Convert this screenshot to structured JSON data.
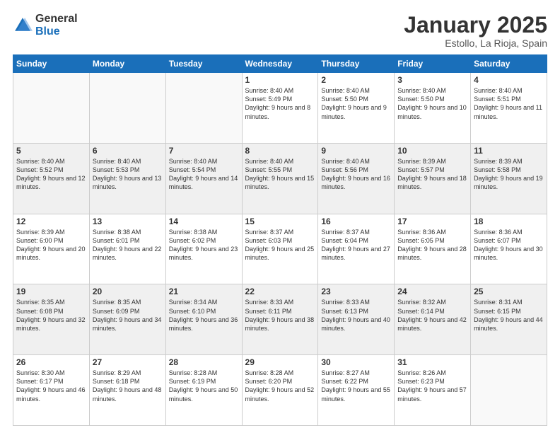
{
  "header": {
    "logo_general": "General",
    "logo_blue": "Blue",
    "month_title": "January 2025",
    "location": "Estollo, La Rioja, Spain"
  },
  "weekdays": [
    "Sunday",
    "Monday",
    "Tuesday",
    "Wednesday",
    "Thursday",
    "Friday",
    "Saturday"
  ],
  "weeks": [
    [
      {
        "day": "",
        "empty": true
      },
      {
        "day": "",
        "empty": true
      },
      {
        "day": "",
        "empty": true
      },
      {
        "day": "1",
        "sunrise": "8:40 AM",
        "sunset": "5:49 PM",
        "daylight": "9 hours and 8 minutes."
      },
      {
        "day": "2",
        "sunrise": "8:40 AM",
        "sunset": "5:50 PM",
        "daylight": "9 hours and 9 minutes."
      },
      {
        "day": "3",
        "sunrise": "8:40 AM",
        "sunset": "5:50 PM",
        "daylight": "9 hours and 10 minutes."
      },
      {
        "day": "4",
        "sunrise": "8:40 AM",
        "sunset": "5:51 PM",
        "daylight": "9 hours and 11 minutes."
      }
    ],
    [
      {
        "day": "5",
        "sunrise": "8:40 AM",
        "sunset": "5:52 PM",
        "daylight": "9 hours and 12 minutes."
      },
      {
        "day": "6",
        "sunrise": "8:40 AM",
        "sunset": "5:53 PM",
        "daylight": "9 hours and 13 minutes."
      },
      {
        "day": "7",
        "sunrise": "8:40 AM",
        "sunset": "5:54 PM",
        "daylight": "9 hours and 14 minutes."
      },
      {
        "day": "8",
        "sunrise": "8:40 AM",
        "sunset": "5:55 PM",
        "daylight": "9 hours and 15 minutes."
      },
      {
        "day": "9",
        "sunrise": "8:40 AM",
        "sunset": "5:56 PM",
        "daylight": "9 hours and 16 minutes."
      },
      {
        "day": "10",
        "sunrise": "8:39 AM",
        "sunset": "5:57 PM",
        "daylight": "9 hours and 18 minutes."
      },
      {
        "day": "11",
        "sunrise": "8:39 AM",
        "sunset": "5:58 PM",
        "daylight": "9 hours and 19 minutes."
      }
    ],
    [
      {
        "day": "12",
        "sunrise": "8:39 AM",
        "sunset": "6:00 PM",
        "daylight": "9 hours and 20 minutes."
      },
      {
        "day": "13",
        "sunrise": "8:38 AM",
        "sunset": "6:01 PM",
        "daylight": "9 hours and 22 minutes."
      },
      {
        "day": "14",
        "sunrise": "8:38 AM",
        "sunset": "6:02 PM",
        "daylight": "9 hours and 23 minutes."
      },
      {
        "day": "15",
        "sunrise": "8:37 AM",
        "sunset": "6:03 PM",
        "daylight": "9 hours and 25 minutes."
      },
      {
        "day": "16",
        "sunrise": "8:37 AM",
        "sunset": "6:04 PM",
        "daylight": "9 hours and 27 minutes."
      },
      {
        "day": "17",
        "sunrise": "8:36 AM",
        "sunset": "6:05 PM",
        "daylight": "9 hours and 28 minutes."
      },
      {
        "day": "18",
        "sunrise": "8:36 AM",
        "sunset": "6:07 PM",
        "daylight": "9 hours and 30 minutes."
      }
    ],
    [
      {
        "day": "19",
        "sunrise": "8:35 AM",
        "sunset": "6:08 PM",
        "daylight": "9 hours and 32 minutes."
      },
      {
        "day": "20",
        "sunrise": "8:35 AM",
        "sunset": "6:09 PM",
        "daylight": "9 hours and 34 minutes."
      },
      {
        "day": "21",
        "sunrise": "8:34 AM",
        "sunset": "6:10 PM",
        "daylight": "9 hours and 36 minutes."
      },
      {
        "day": "22",
        "sunrise": "8:33 AM",
        "sunset": "6:11 PM",
        "daylight": "9 hours and 38 minutes."
      },
      {
        "day": "23",
        "sunrise": "8:33 AM",
        "sunset": "6:13 PM",
        "daylight": "9 hours and 40 minutes."
      },
      {
        "day": "24",
        "sunrise": "8:32 AM",
        "sunset": "6:14 PM",
        "daylight": "9 hours and 42 minutes."
      },
      {
        "day": "25",
        "sunrise": "8:31 AM",
        "sunset": "6:15 PM",
        "daylight": "9 hours and 44 minutes."
      }
    ],
    [
      {
        "day": "26",
        "sunrise": "8:30 AM",
        "sunset": "6:17 PM",
        "daylight": "9 hours and 46 minutes."
      },
      {
        "day": "27",
        "sunrise": "8:29 AM",
        "sunset": "6:18 PM",
        "daylight": "9 hours and 48 minutes."
      },
      {
        "day": "28",
        "sunrise": "8:28 AM",
        "sunset": "6:19 PM",
        "daylight": "9 hours and 50 minutes."
      },
      {
        "day": "29",
        "sunrise": "8:28 AM",
        "sunset": "6:20 PM",
        "daylight": "9 hours and 52 minutes."
      },
      {
        "day": "30",
        "sunrise": "8:27 AM",
        "sunset": "6:22 PM",
        "daylight": "9 hours and 55 minutes."
      },
      {
        "day": "31",
        "sunrise": "8:26 AM",
        "sunset": "6:23 PM",
        "daylight": "9 hours and 57 minutes."
      },
      {
        "day": "",
        "empty": true
      }
    ]
  ]
}
